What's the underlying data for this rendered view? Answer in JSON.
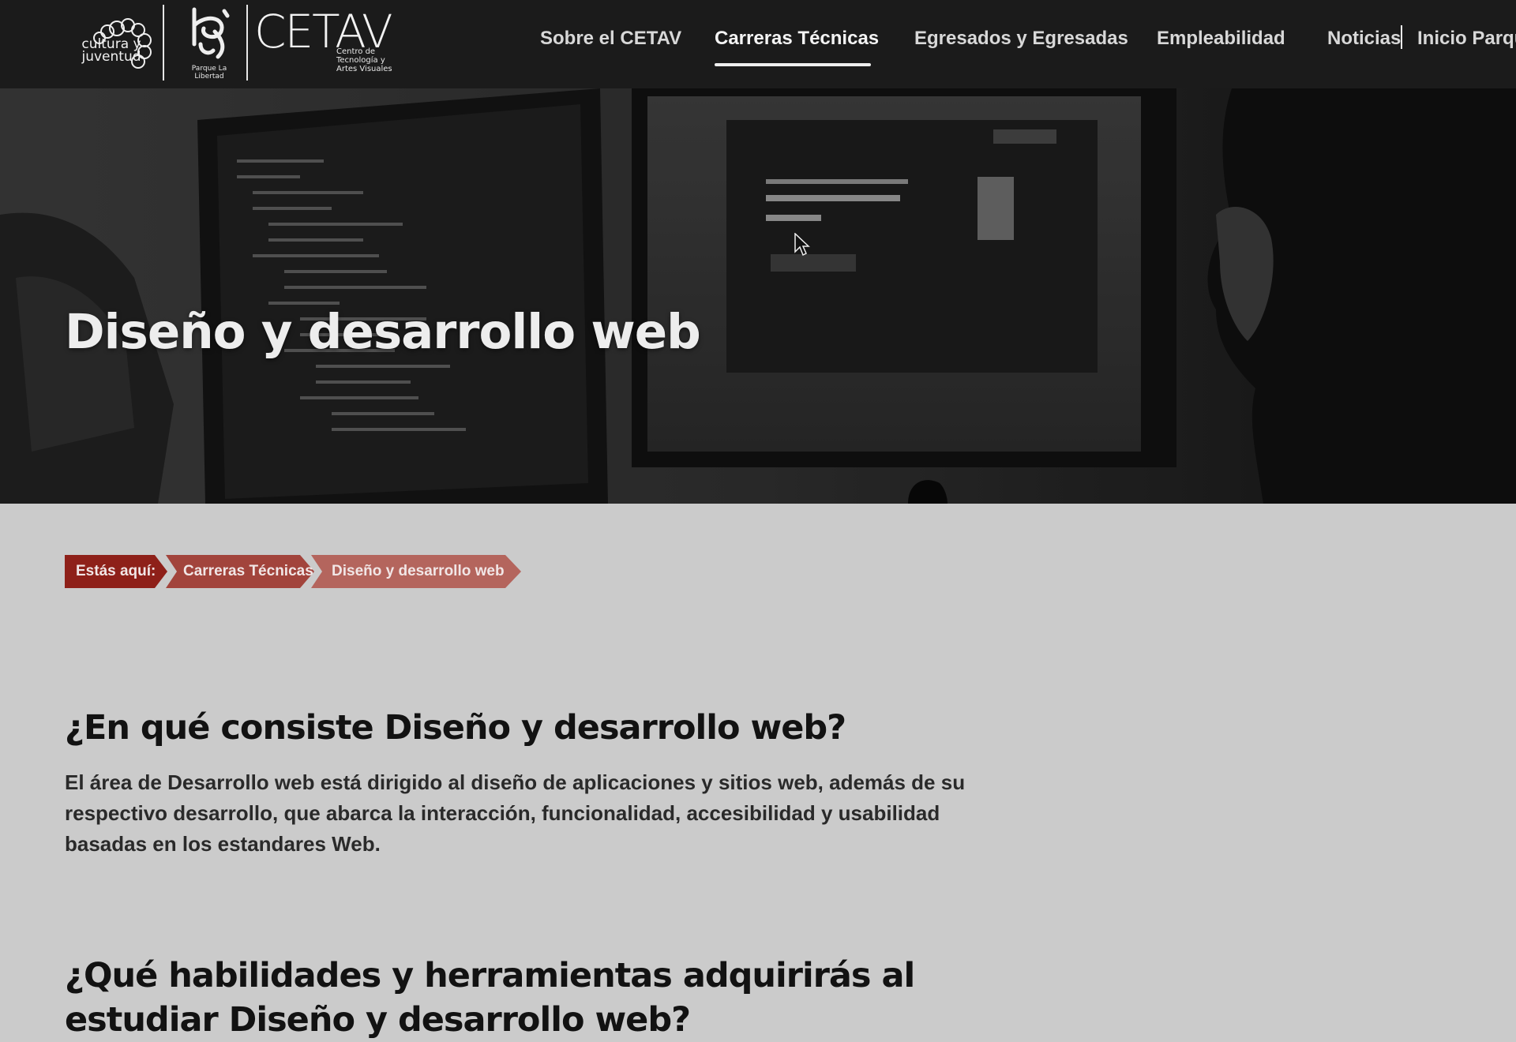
{
  "header": {
    "logo_cultura_text": "cultura y juventud",
    "logo_libertad_text": "Parque La Libertad",
    "logo_cetav_word": "CETAV",
    "logo_cetav_sub": "Centro de Tecnología y Artes Visuales",
    "nav": [
      {
        "label": "Sobre el CETAV",
        "active": false
      },
      {
        "label": "Carreras Técnicas",
        "active": true
      },
      {
        "label": "Egresados y Egresadas",
        "active": false
      },
      {
        "label": "Empleabilidad",
        "active": false
      },
      {
        "label": "Noticias",
        "active": false
      },
      {
        "label": "Inicio Parque",
        "active": false
      }
    ]
  },
  "hero": {
    "title": "Diseño y desarrollo web"
  },
  "breadcrumb": {
    "items": [
      "Estás aquí:",
      "Carreras Técnicas",
      "Diseño y desarrollo web"
    ]
  },
  "content": {
    "section1_heading": "¿En qué consiste Diseño y desarrollo web?",
    "section1_text": "El área de Desarrollo web está dirigido al diseño de aplicaciones y sitios web, además de su respectivo desarrollo, que abarca la interacción, funcionalidad, accesibilidad y usabilidad basadas en los estandares Web.",
    "section2_heading": "¿Qué habilidades y herramientas adquirirás al estudiar Diseño y desarrollo web?"
  },
  "colors": {
    "header_bg": "#1b1b1b",
    "page_bg": "#cbcbcb",
    "crumb_dark": "#8e2019",
    "crumb_mid": "#a2443c",
    "crumb_light": "#b4655d"
  }
}
